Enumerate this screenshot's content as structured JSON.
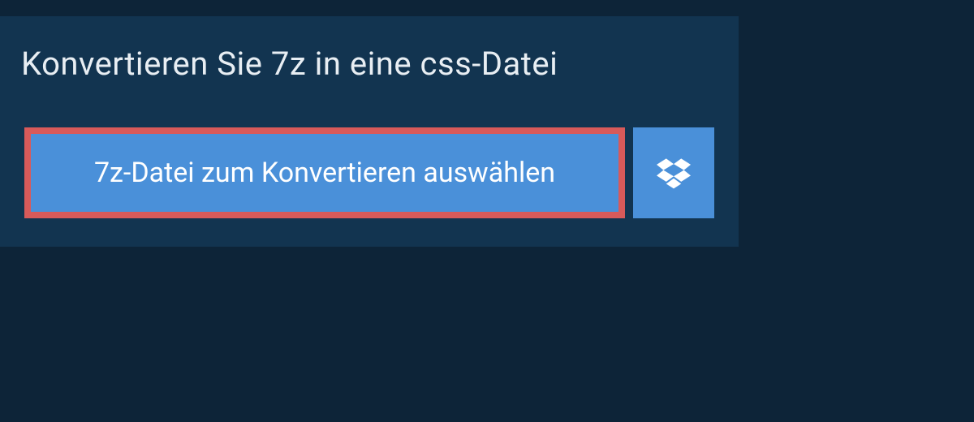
{
  "heading": "Konvertieren Sie 7z in eine css-Datei",
  "select_button_label": "7z-Datei zum Konvertieren auswählen",
  "colors": {
    "page_bg": "#0d2438",
    "panel_bg": "#123450",
    "button_bg": "#4a90d9",
    "highlight_border": "#d85a5a",
    "text_light": "#e8eef3",
    "text_white": "#ffffff"
  }
}
